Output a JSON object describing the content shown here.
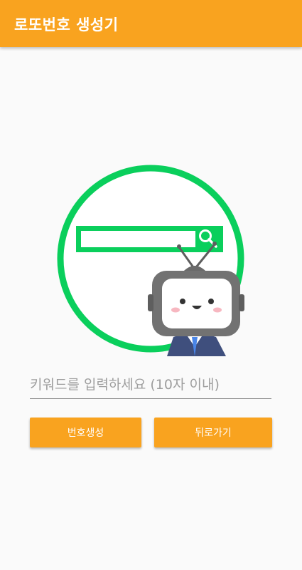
{
  "app_bar": {
    "title": "로또번호 생성기"
  },
  "hero": {
    "icon": "search-mascot-illustration",
    "ring_color": "#0acf5c",
    "mascot_color": "#727272"
  },
  "keyword_input": {
    "value": "",
    "placeholder": "키워드를 입력하세요 (10자 이내)"
  },
  "actions": {
    "generate_label": "번호생성",
    "back_label": "뒤로가기"
  },
  "colors": {
    "accent": "#f9a31f",
    "background": "#fafafa"
  }
}
